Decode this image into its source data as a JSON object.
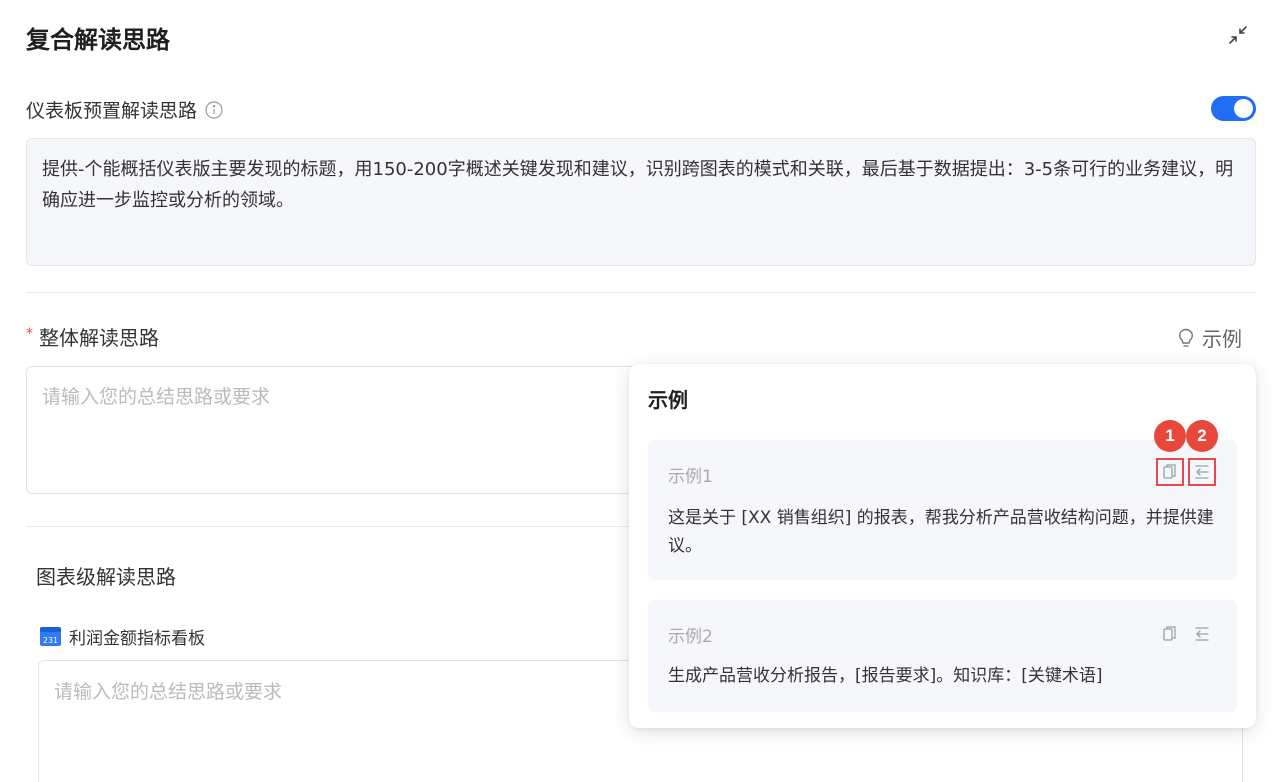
{
  "header": {
    "title": "复合解读思路",
    "collapse_icon": "collapse-icon"
  },
  "preset": {
    "label": "仪表板预置解读思路",
    "info_icon": "info-icon",
    "toggle_on": true,
    "toggle_color": "#1f6ef5",
    "text": "提供-个能概括仪表版主要发现的标题，用150-200字概述关键发现和建议，识别跨图表的模式和关联，最后基于数据提出：3-5条可行的业务建议，明确应进一步监控或分析的领域。"
  },
  "overall": {
    "required_mark": "*",
    "label": "整体解读思路",
    "example_link": "示例",
    "placeholder": "请输入您的总结思路或要求"
  },
  "chart_level": {
    "label": "图表级解读思路",
    "chart_name": "利润金额指标看板",
    "chart_icon_text": "231",
    "placeholder": "请输入您的总结思路或要求"
  },
  "examples_popup": {
    "title": "示例",
    "cards": [
      {
        "label": "示例1",
        "text": "这是关于 [XX 销售组织] 的报表，帮我分析产品营收结构问题，并提供建议。"
      },
      {
        "label": "示例2",
        "text": "生成产品营收分析报告，[报告要求]。知识库：[关键术语]"
      }
    ],
    "annotations": [
      "1",
      "2"
    ],
    "highlight_color": "#e5484d"
  }
}
